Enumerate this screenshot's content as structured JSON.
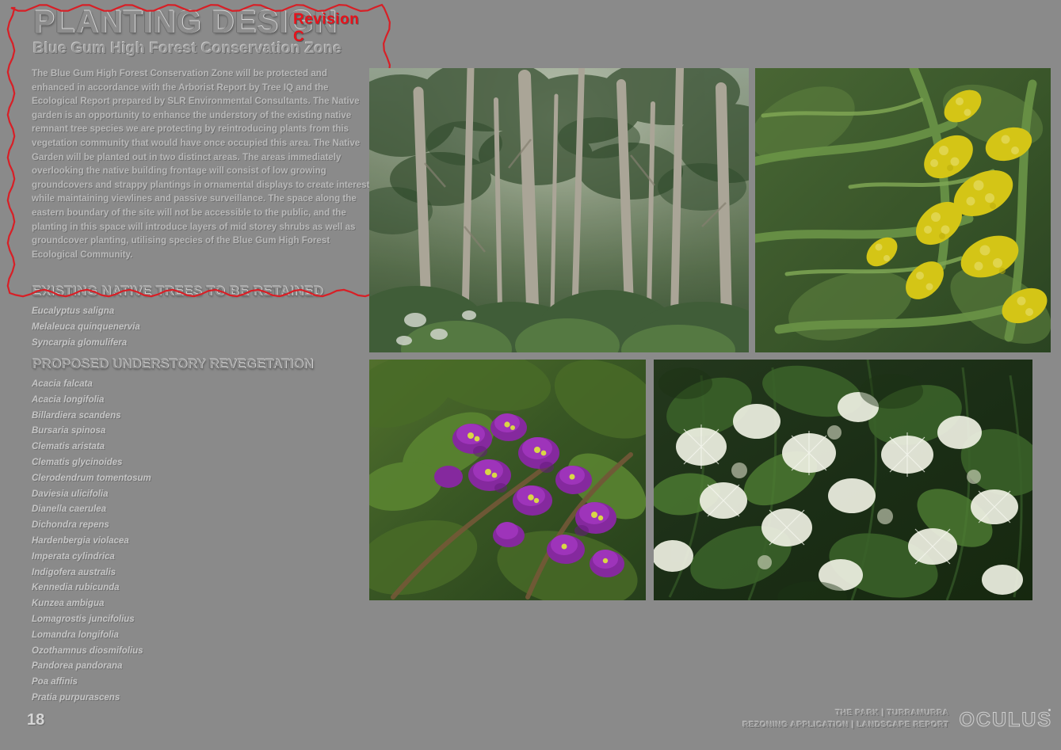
{
  "document": {
    "title": "PLANTING DESIGN",
    "subtitle": "Blue Gum High Forest Conservation Zone",
    "revision": "Revision C",
    "page_number": "18",
    "background_color": "#8a8a8a",
    "annotation_color": "#d81f26",
    "revision_color": "#e8121b"
  },
  "body": {
    "paragraph": "The Blue Gum High Forest Conservation Zone will be protected and enhanced in accordance with the Arborist Report by Tree IQ and the Ecological Report prepared by SLR Environmental Consultants. The Native garden is an opportunity to enhance the understory of the existing native remnant tree species we are protecting by reintroducing plants from this vegetation community that would have once occupied this area. The Native Garden will be planted out in two distinct areas. The areas immediately overlooking the native building frontage will consist of low growing groundcovers and strappy plantings in ornamental displays to create interest while maintaining viewlines and passive surveillance. The space along the eastern boundary of the site will not be accessible to the public, and the planting in this space will introduce layers of mid storey shrubs as well as groundcover planting, utilising species of the Blue Gum High Forest Ecological Community."
  },
  "sections": [
    {
      "id": "retained",
      "heading": "EXISTING NATIVE TREES TO BE RETAINED",
      "plants": [
        "Eucalyptus saligna",
        "Melaleuca quinquenervia",
        "Syncarpia glomulifera"
      ]
    },
    {
      "id": "revegetation",
      "heading": "PROPOSED UNDERSTORY REVEGETATION",
      "plants": [
        "Acacia falcata",
        "Acacia longifolia",
        "Billardiera scandens",
        "Bursaria spinosa",
        "Clematis aristata",
        "Clematis glycinoides",
        "Clerodendrum tomentosum",
        "Daviesia ulicifolia",
        "Dianella caerulea",
        "Dichondra repens",
        "Hardenbergia violacea",
        "Imperata cylindrica",
        "Indigofera australis",
        "Kennedia rubicunda",
        "Kunzea ambigua",
        "Lomagrostis juncifolius",
        "Lomandra longifolia",
        "Ozothamnus diosmifolius",
        "Pandorea pandorana",
        "Poa affinis",
        "Pratia purpurascens"
      ]
    }
  ],
  "photos": [
    {
      "id": "forest",
      "caption": "eucalyptus forest understory"
    },
    {
      "id": "acacia",
      "caption": "yellow acacia flower spikes"
    },
    {
      "id": "hardenbergia",
      "caption": "purple hardenbergia flowers"
    },
    {
      "id": "melaleuca",
      "caption": "white melaleuca blossom"
    }
  ],
  "footer": {
    "line1": "THE PARK  |  TURRAMURRA",
    "line2": "REZONING APPLICATION  |  LANDSCAPE REPORT",
    "logo": "OCULUS"
  }
}
